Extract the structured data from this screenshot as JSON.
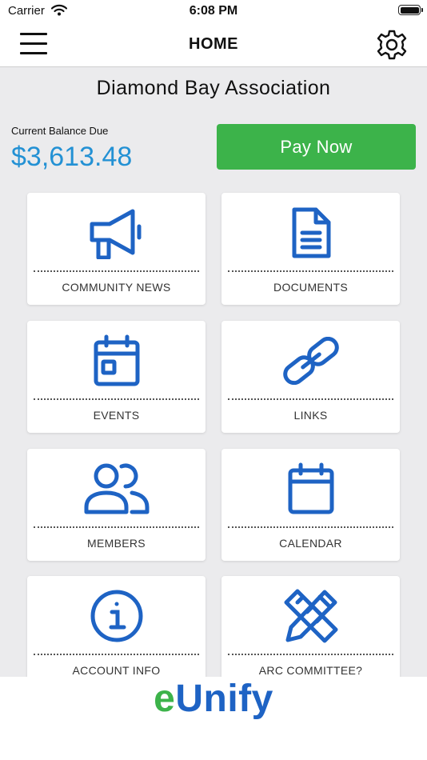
{
  "status_bar": {
    "carrier": "Carrier",
    "time": "6:08 PM"
  },
  "nav": {
    "title": "HOME",
    "menu_icon": "hamburger-menu-icon",
    "settings_icon": "gear-icon"
  },
  "association": {
    "name": "Diamond Bay Association"
  },
  "balance": {
    "label": "Current Balance Due",
    "amount": "$3,613.48",
    "pay_label": "Pay Now"
  },
  "tiles": [
    {
      "label": "COMMUNITY NEWS",
      "icon": "megaphone-icon"
    },
    {
      "label": "DOCUMENTS",
      "icon": "document-icon"
    },
    {
      "label": "EVENTS",
      "icon": "event-calendar-icon"
    },
    {
      "label": "LINKS",
      "icon": "link-icon"
    },
    {
      "label": "MEMBERS",
      "icon": "members-icon"
    },
    {
      "label": "CALENDAR",
      "icon": "calendar-icon"
    },
    {
      "label": "ACCOUNT INFO",
      "icon": "info-icon"
    },
    {
      "label": "ARC COMMITTEE?",
      "icon": "pencil-ruler-icon"
    }
  ],
  "footer": {
    "brand_e": "e",
    "brand_rest": "Unify"
  },
  "colors": {
    "accent_blue": "#1e63c4",
    "balance_blue": "#2391d4",
    "pay_green": "#3cb34a",
    "background": "#ebebed"
  }
}
